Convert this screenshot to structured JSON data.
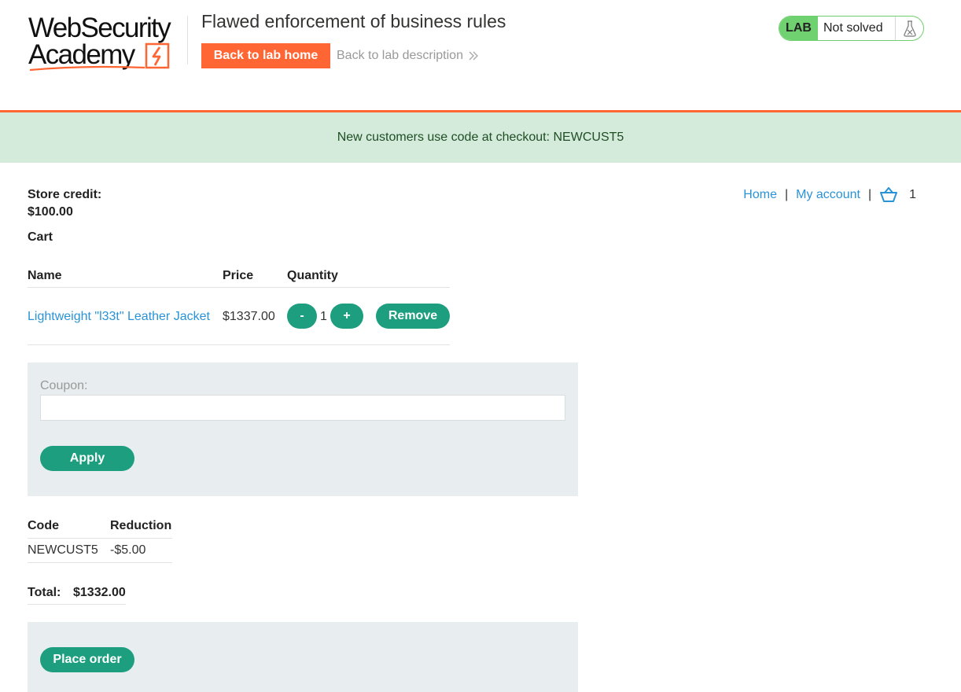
{
  "header": {
    "logo_line1": "WebSecurity",
    "logo_line2": "Academy",
    "lab_title": "Flawed enforcement of business rules",
    "back_home_label": "Back to lab home",
    "back_description_label": "Back to lab description",
    "lab_tag": "LAB",
    "lab_status": "Not solved",
    "accent_color": "#ff6633",
    "status_color": "#70d170"
  },
  "notice": {
    "text": "New customers use code at checkout: NEWCUST5"
  },
  "account": {
    "store_credit_label": "Store credit:",
    "store_credit_value": "$100.00"
  },
  "nav": {
    "home": "Home",
    "separator": "|",
    "my_account": "My account",
    "cart_count": "1"
  },
  "cart": {
    "heading": "Cart",
    "columns": [
      "Name",
      "Price",
      "Quantity"
    ],
    "items": [
      {
        "name": "Lightweight \"l33t\" Leather Jacket",
        "price": "$1337.00",
        "quantity": "1",
        "decrement_label": "-",
        "increment_label": "+",
        "remove_label": "Remove"
      }
    ]
  },
  "coupon": {
    "label": "Coupon:",
    "value": "",
    "apply_label": "Apply"
  },
  "reductions": {
    "columns": [
      "Code",
      "Reduction"
    ],
    "rows": [
      {
        "code": "NEWCUST5",
        "reduction": "-$5.00"
      }
    ]
  },
  "total": {
    "label": "Total:",
    "value": "$1332.00"
  },
  "order": {
    "place_order_label": "Place order",
    "button_color": "#1c9e7f"
  }
}
